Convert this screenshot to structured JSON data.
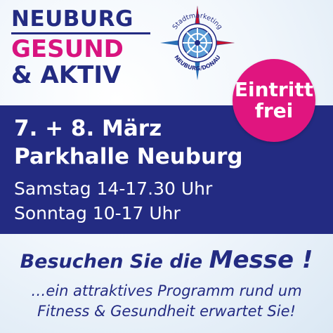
{
  "brand": {
    "line1": "NEUBURG",
    "line2": "GESUND",
    "line3": "& AKTIV"
  },
  "logo": {
    "top_text": "Stadtmarketing",
    "bottom_text": "NEUBURG/DONAU",
    "colors": {
      "blue": "#2a6fb5",
      "red": "#c8102e",
      "navy": "#232b82"
    }
  },
  "badge": {
    "line1": "Eintritt",
    "line2": "frei",
    "color": "#e0157f"
  },
  "event": {
    "date": "7. + 8. März",
    "venue": "Parkhalle Neuburg",
    "saturday": "Samstag 14-17.30 Uhr",
    "sunday": "Sonntag 10-17 Uhr",
    "banner_color": "#232b82"
  },
  "cta": {
    "lead": "Besuchen Sie die ",
    "emph": "Messe",
    "end": " !"
  },
  "tagline": {
    "line1": "…ein attraktives Programm rund um",
    "line2": "Fitness & Gesundheit erwartet Sie!"
  }
}
